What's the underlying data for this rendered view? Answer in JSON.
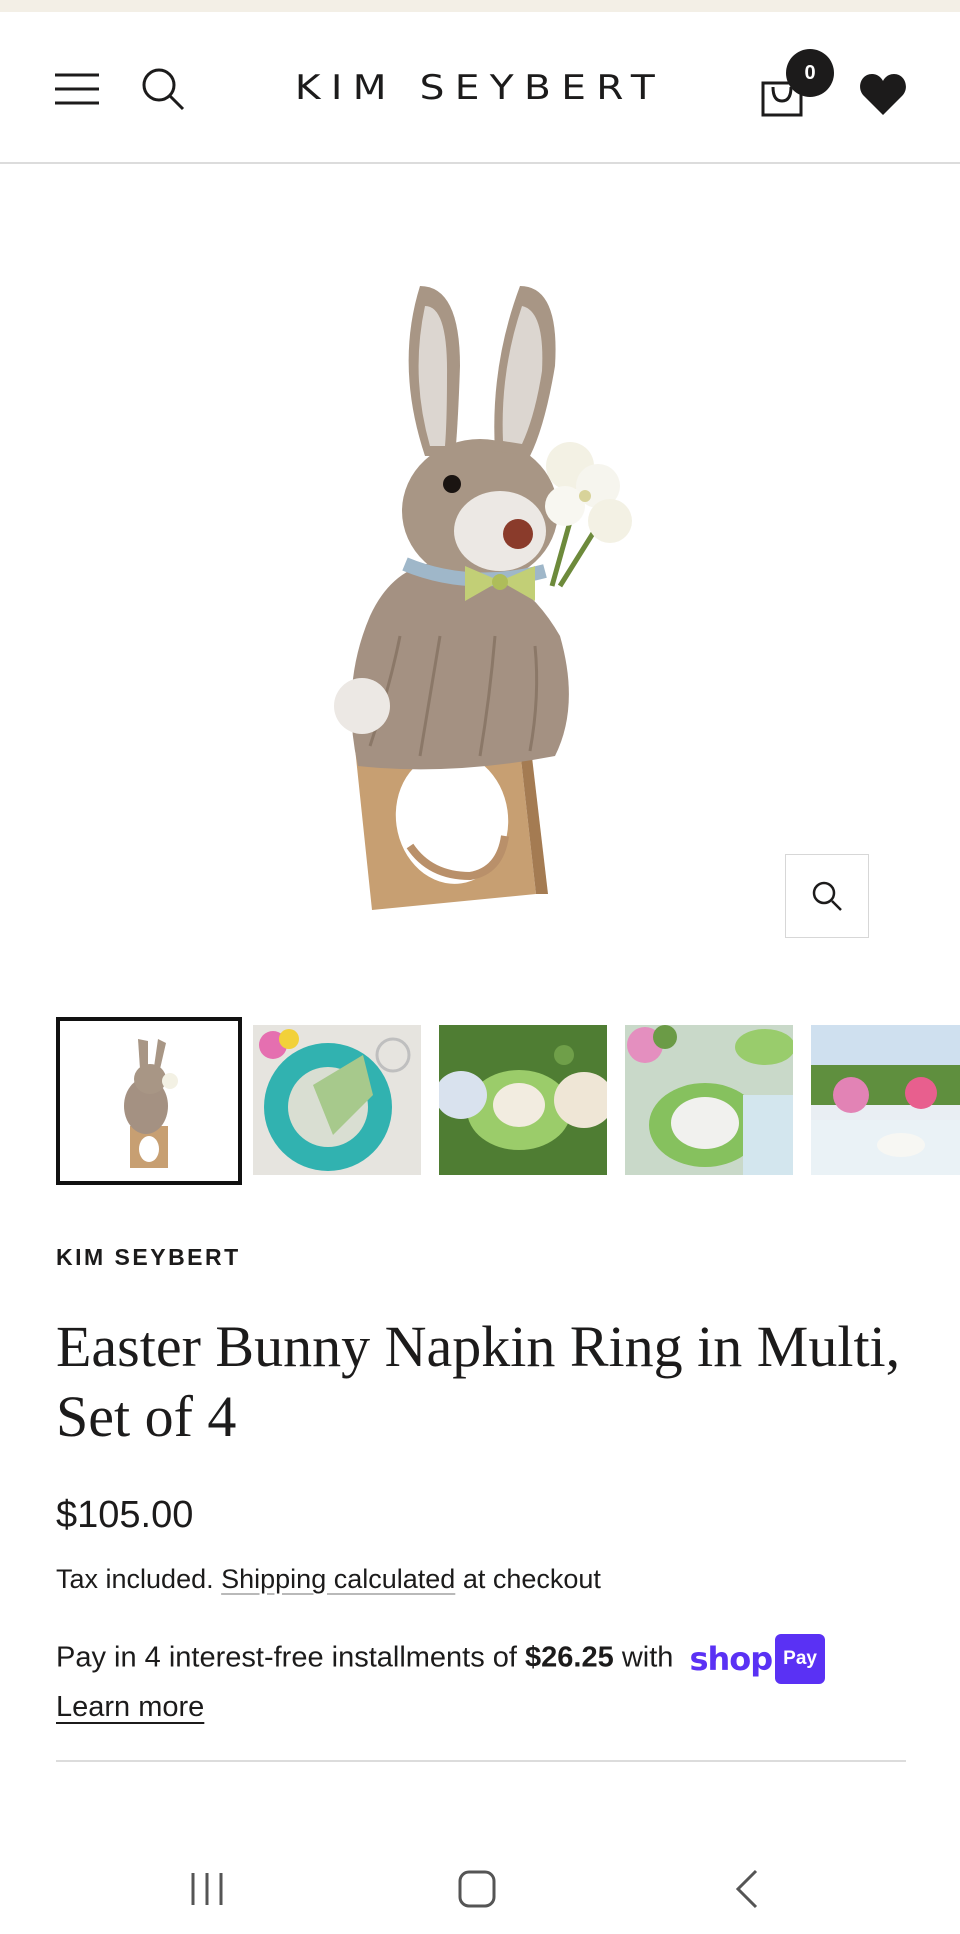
{
  "header": {
    "logo_text": "KIM SEYBERT",
    "cart_count": "0"
  },
  "product": {
    "vendor": "KIM SEYBERT",
    "title": "Easter Bunny Napkin Ring in Multi, Set of 4",
    "price": "$105.00",
    "tax_prefix": "Tax included.",
    "shipping_link": "Shipping calculated",
    "tax_suffix": "at checkout",
    "installments_prefix": "Pay in 4 interest-free installments of",
    "installment_amount": "$26.25",
    "installments_with": "with",
    "shop_pay_word": "shop",
    "shop_pay_pill": "Pay",
    "learn_more": "Learn more"
  },
  "gallery": {
    "thumbnail_count": 5,
    "active_index": 0
  },
  "colors": {
    "text": "#1c1b1b",
    "divider": "#dcdcdc",
    "shop_pay": "#5a31f4",
    "top_strip": "#f3efe6"
  },
  "icons": {
    "menu": "hamburger-icon",
    "search": "search-icon",
    "cart": "shopping-bag-icon",
    "wishlist": "heart-icon",
    "zoom": "zoom-icon"
  }
}
